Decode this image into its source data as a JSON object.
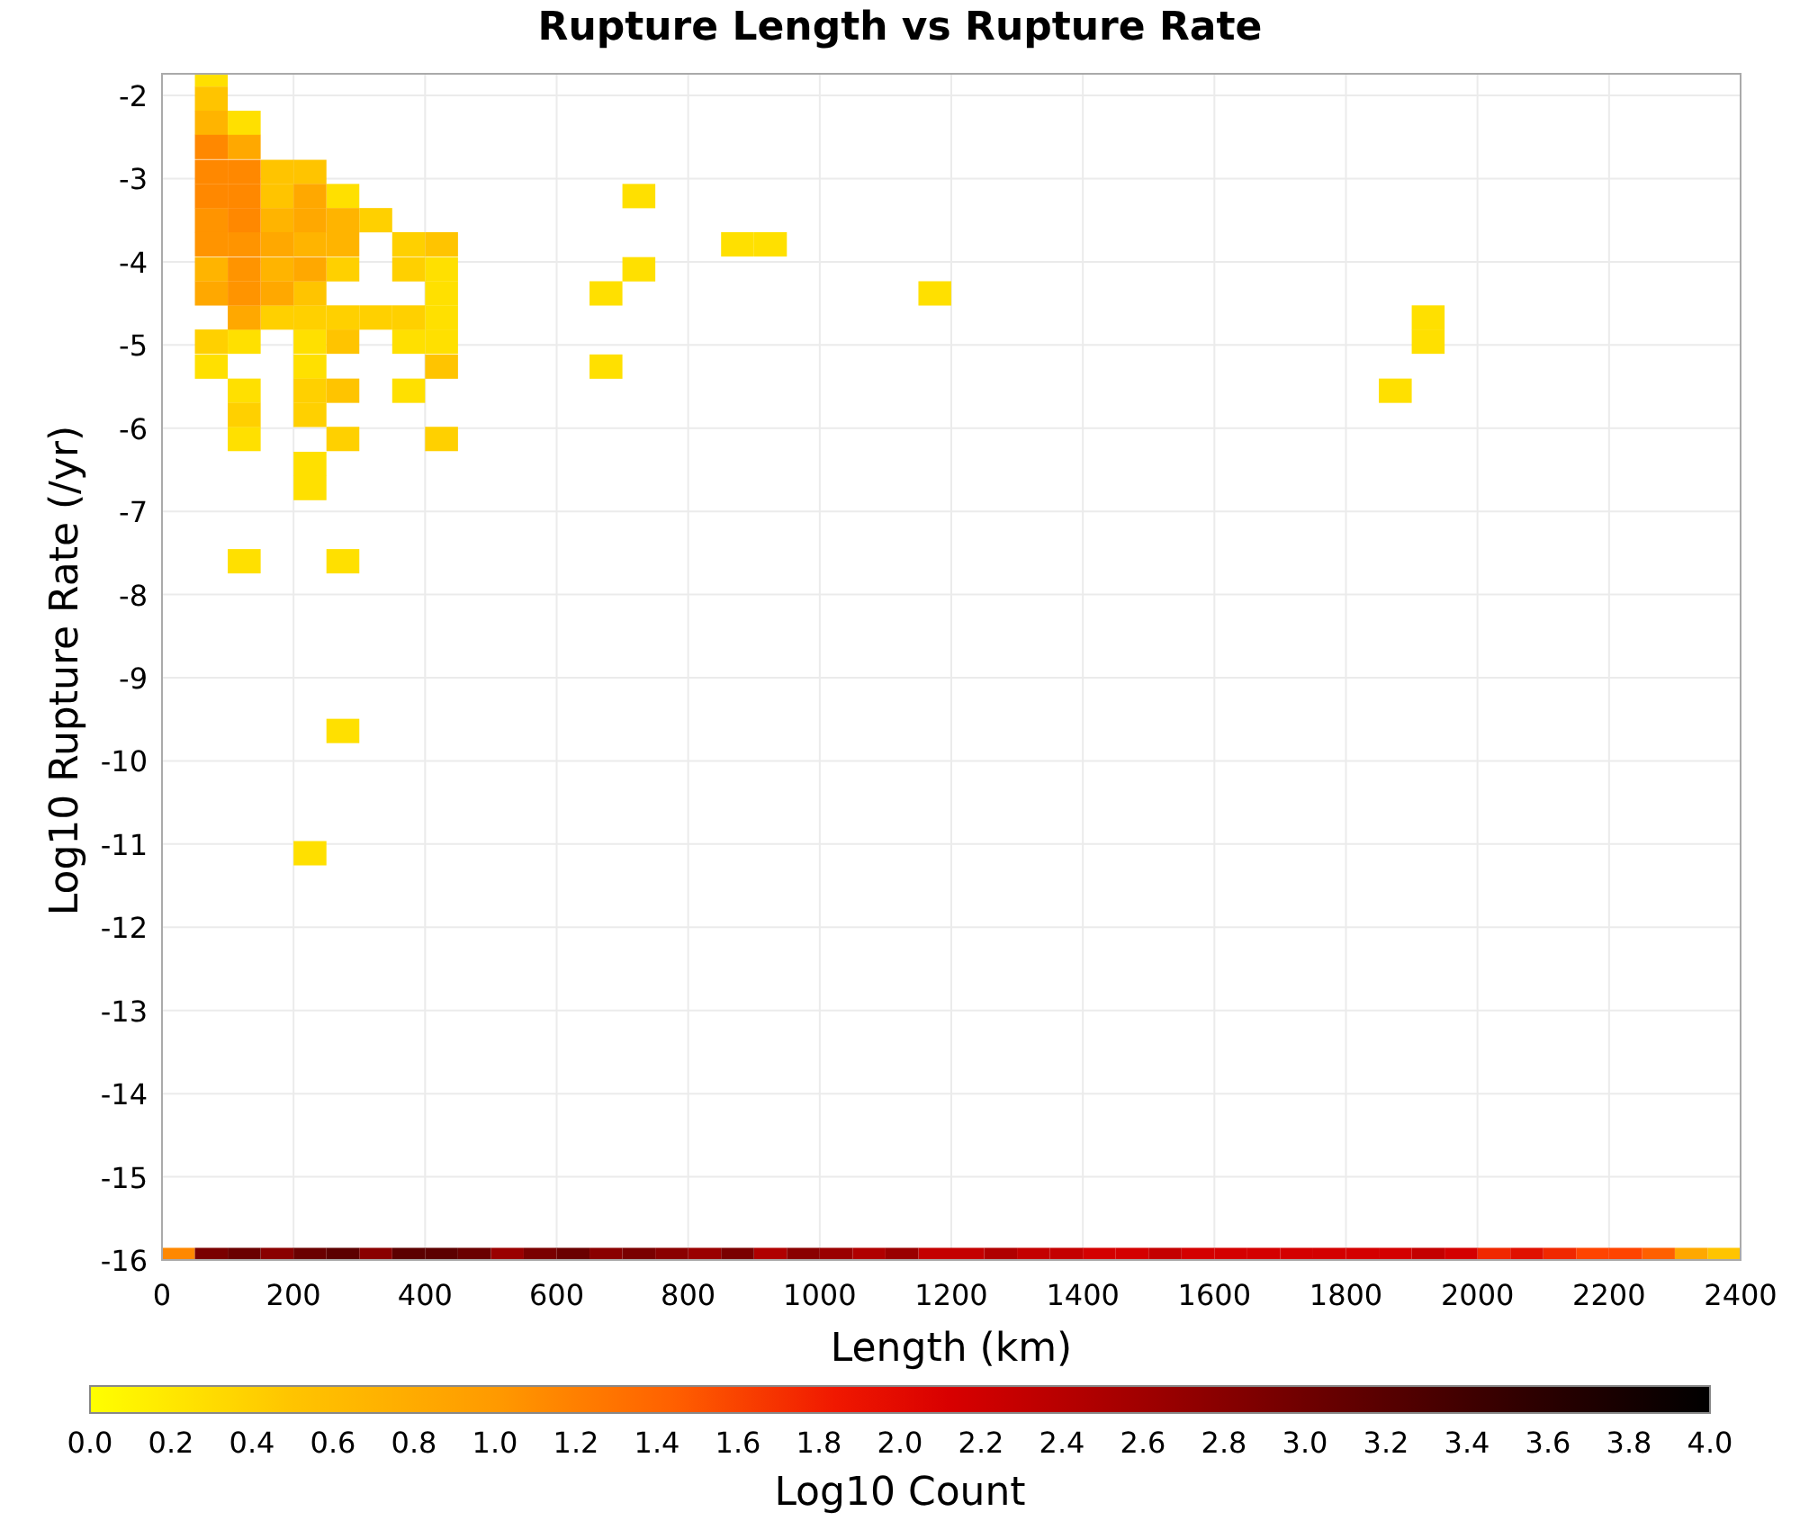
{
  "chart": {
    "chart_data": {
      "type": "scatter",
      "grid": true,
      "title": "Rupture Length vs Rupture Rate",
      "xlabel": "Length (km)",
      "ylabel": "Log10 Rupture Rate (/yr)",
      "xlim": [
        0,
        2400
      ],
      "ylim": [
        -16,
        -1.74
      ],
      "xticks": [
        0,
        200,
        400,
        600,
        800,
        1000,
        1200,
        1400,
        1600,
        1800,
        2000,
        2200,
        2400
      ],
      "yticks": [
        -16,
        -15,
        -14,
        -13,
        -12,
        -11,
        -10,
        -9,
        -8,
        -7,
        -6,
        -5,
        -4,
        -3,
        -2
      ],
      "series": [
        {
          "color": "#ffe000",
          "x": [
            75,
            125,
            275,
            425,
            425,
            425,
            125,
            225,
            375,
            425,
            75,
            225,
            125,
            375,
            125,
            225,
            225,
            725,
            875,
            925,
            725,
            675,
            1175,
            675,
            1925,
            1925,
            1875,
            125,
            275,
            275,
            225
          ],
          "values": [
            -1.75,
            -2.33,
            -3.21,
            -4.09,
            -4.38,
            -4.67,
            -4.96,
            -4.96,
            -4.96,
            -4.96,
            -5.26,
            -5.26,
            -5.55,
            -5.55,
            -6.13,
            -6.43,
            -6.72,
            -3.21,
            -3.79,
            -3.79,
            -4.09,
            -4.38,
            -4.38,
            -5.26,
            -4.67,
            -4.96,
            -5.55,
            -7.6,
            -7.6,
            -9.64,
            -11.11
          ]
        },
        {
          "color": "#ffd000",
          "x": [
            325,
            375,
            275,
            375,
            175,
            225,
            275,
            325,
            375,
            75,
            225,
            125,
            225,
            275,
            425
          ],
          "values": [
            -3.5,
            -3.79,
            -4.09,
            -4.09,
            -4.67,
            -4.67,
            -4.67,
            -4.67,
            -4.67,
            -4.96,
            -5.55,
            -5.84,
            -5.84,
            -6.13,
            -6.13
          ]
        },
        {
          "color": "#ffc400",
          "x": [
            75,
            175,
            225,
            175,
            425,
            225,
            275,
            425,
            275,
            2375
          ],
          "values": [
            -2.04,
            -2.92,
            -2.92,
            -3.21,
            -3.79,
            -4.38,
            -4.96,
            -5.26,
            -5.55,
            -16
          ]
        },
        {
          "color": "#ffb400",
          "x": [
            75,
            175,
            275,
            225,
            275,
            75,
            175
          ],
          "values": [
            -2.33,
            -3.5,
            -3.5,
            -3.79,
            -3.79,
            -4.09,
            -4.09
          ]
        },
        {
          "color": "#ffa800",
          "x": [
            125,
            225,
            225,
            175,
            225,
            75,
            175,
            125,
            2325
          ],
          "values": [
            -2.62,
            -3.21,
            -3.5,
            -3.79,
            -4.09,
            -4.38,
            -4.38,
            -4.67,
            -16
          ]
        },
        {
          "color": "#ff9400",
          "x": [
            75,
            75,
            125,
            125,
            125
          ],
          "values": [
            -3.5,
            -3.79,
            -3.79,
            -4.09,
            -4.38
          ]
        },
        {
          "color": "#ff8800",
          "x": [
            75,
            75,
            125,
            75,
            125,
            125,
            25
          ],
          "values": [
            -2.62,
            -2.92,
            -2.92,
            -3.21,
            -3.21,
            -3.5,
            -16
          ]
        },
        {
          "color": "#ff6000",
          "x": [
            2275
          ],
          "values": [
            -16
          ]
        },
        {
          "color": "#ff4400",
          "x": [
            2175,
            2225
          ],
          "values": [
            -16,
            -16
          ]
        },
        {
          "color": "#f02800",
          "x": [
            2025,
            2125
          ],
          "values": [
            -16,
            -16
          ]
        },
        {
          "color": "#e01000",
          "x": [
            2075
          ],
          "values": [
            -16
          ]
        },
        {
          "color": "#d40000",
          "x": [
            1425,
            1475,
            1575,
            1625,
            1675,
            1725,
            1775,
            1825,
            1875,
            1975
          ],
          "values": [
            -16,
            -16,
            -16,
            -16,
            -16,
            -16,
            -16,
            -16,
            -16,
            -16
          ]
        },
        {
          "color": "#c40000",
          "x": [
            1175,
            1225,
            1325,
            1375,
            1525,
            1925
          ],
          "values": [
            -16,
            -16,
            -16,
            -16,
            -16,
            -16
          ]
        },
        {
          "color": "#b00000",
          "x": [
            925,
            1075,
            1275
          ],
          "values": [
            -16,
            -16,
            -16
          ]
        },
        {
          "color": "#9a0000",
          "x": [
            525,
            825,
            1025,
            1125
          ],
          "values": [
            -16,
            -16,
            -16,
            -16
          ]
        },
        {
          "color": "#8a0000",
          "x": [
            175,
            325,
            675,
            775,
            975
          ],
          "values": [
            -16,
            -16,
            -16,
            -16,
            -16
          ]
        },
        {
          "color": "#7a0000",
          "x": [
            75,
            575,
            725,
            875
          ],
          "values": [
            -16,
            -16,
            -16,
            -16
          ]
        },
        {
          "color": "#6a0000",
          "x": [
            125,
            225,
            475,
            625
          ],
          "values": [
            -16,
            -16,
            -16,
            -16
          ]
        },
        {
          "color": "#5c0000",
          "x": [
            275,
            375,
            425
          ],
          "values": [
            -16,
            -16,
            -16
          ]
        }
      ]
    }
  },
  "colorbar": {
    "label": "Log10 Count",
    "ticks": [
      "0.0",
      "0.2",
      "0.4",
      "0.6",
      "0.8",
      "1.0",
      "1.2",
      "1.4",
      "1.6",
      "1.8",
      "2.0",
      "2.2",
      "2.4",
      "2.6",
      "2.8",
      "3.0",
      "3.2",
      "3.4",
      "3.6",
      "3.8",
      "4.0"
    ]
  }
}
